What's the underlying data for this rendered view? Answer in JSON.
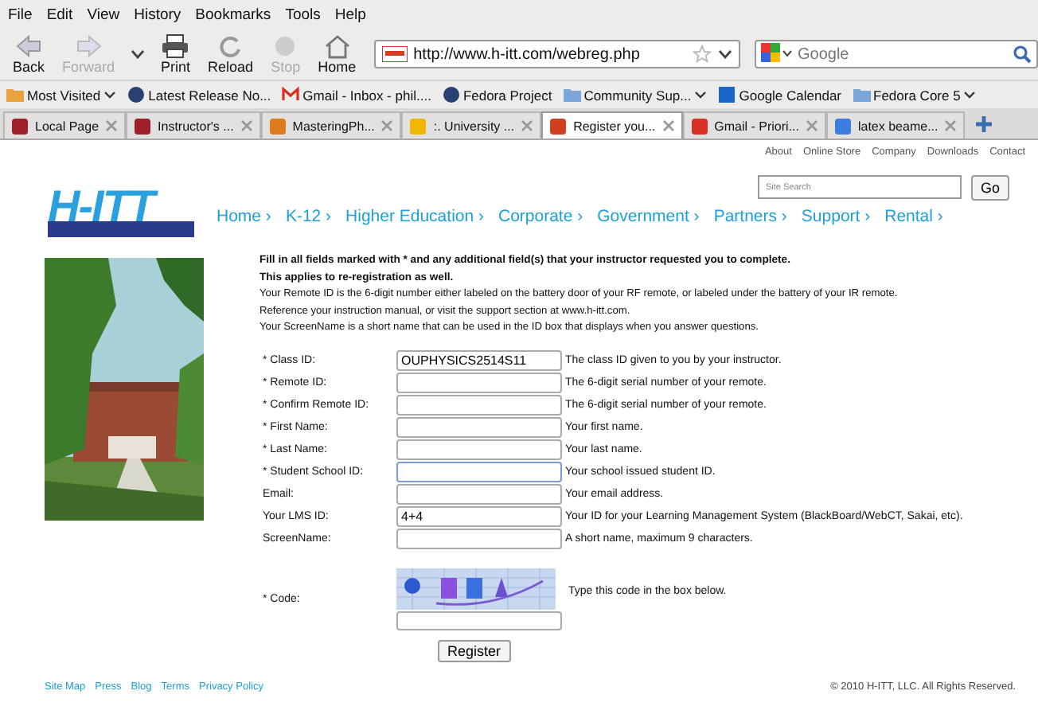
{
  "menu": [
    "File",
    "Edit",
    "View",
    "History",
    "Bookmarks",
    "Tools",
    "Help"
  ],
  "toolbar": [
    {
      "kind": "back",
      "label": "Back",
      "disabled": false
    },
    {
      "kind": "forward",
      "label": "Forward",
      "disabled": true
    },
    {
      "kind": "dropdown"
    },
    {
      "kind": "print",
      "label": "Print",
      "disabled": false
    },
    {
      "kind": "reload",
      "label": "Reload",
      "disabled": false
    },
    {
      "kind": "stop",
      "label": "Stop",
      "disabled": true
    },
    {
      "kind": "home",
      "label": "Home",
      "disabled": false
    }
  ],
  "address": {
    "value": "http://www.h-itt.com/webreg.php"
  },
  "search": {
    "placeholder": "Google"
  },
  "bookmarks": [
    {
      "kind": "folder",
      "label": "Most Visited",
      "menu": true
    },
    {
      "kind": "fedora",
      "label": "Latest Release No...",
      "menu": false
    },
    {
      "kind": "gmail",
      "label": "Gmail - Inbox - phil....",
      "menu": false
    },
    {
      "kind": "fedora",
      "label": "Fedora Project",
      "menu": false
    },
    {
      "kind": "folder",
      "label": "Community Sup...",
      "menu": true
    },
    {
      "kind": "calendar",
      "label": "Google Calendar",
      "menu": false
    },
    {
      "kind": "folder",
      "label": "Fedora Core 5",
      "menu": true
    }
  ],
  "tabs": [
    {
      "kind": "local",
      "label": "Local Page",
      "selected": false
    },
    {
      "kind": "local",
      "label": "Instructor's ...",
      "selected": false
    },
    {
      "kind": "mastering",
      "label": "MasteringPh...",
      "selected": false
    },
    {
      "kind": "star",
      "label": ":. University ...",
      "selected": false
    },
    {
      "kind": "hitt",
      "label": "Register you...",
      "selected": true
    },
    {
      "kind": "gmail",
      "label": "Gmail - Priori...",
      "selected": false
    },
    {
      "kind": "google",
      "label": "latex beame...",
      "selected": false
    }
  ],
  "page": {
    "top_links": [
      "About",
      "Online Store",
      "Company",
      "Downloads",
      "Contact"
    ],
    "logo": "H-ITT",
    "site_search": {
      "placeholder": "Site Search",
      "button": "Go"
    },
    "nav": [
      "Home ›",
      "K-12 ›",
      "Higher Education ›",
      "Corporate ›",
      "Government ›",
      "Partners ›",
      "Support ›",
      "Rental ›"
    ],
    "photo": {
      "kind": "picture"
    },
    "intro_bold": [
      "Fill in all fields marked with * and any additional field(s) that your instructor requested you to complete.",
      "This applies to re-registration as well."
    ],
    "intro": [
      "Your Remote ID is the 6-digit number either labeled on the battery door of your RF remote, or labeled under the battery of your IR remote.",
      "Reference your instruction manual, or visit the support section at www.h-itt.com.",
      "Your ScreenName is a short name that can be used in the ID box that displays when you answer questions."
    ],
    "fields": [
      {
        "label": "* Class ID:",
        "value": "OUPHYSICS2514S11",
        "help": "The class ID given to you by your instructor.",
        "focused": false
      },
      {
        "label": "* Remote ID:",
        "help": "The 6-digit serial number of your remote.",
        "focused": false
      },
      {
        "label": "* Confirm Remote ID:",
        "help": "The 6-digit serial number of your remote.",
        "focused": false
      },
      {
        "label": "* First Name:",
        "help": "Your first name.",
        "focused": false
      },
      {
        "label": "* Last Name:",
        "help": "Your last name.",
        "focused": false
      },
      {
        "label": "* Student School ID:",
        "help": "Your school issued student ID.",
        "focused": true
      },
      {
        "label": "Email:",
        "help": "Your email address.",
        "focused": false
      },
      {
        "label": "Your LMS ID:",
        "value": "4+4",
        "help": "Your ID for your Learning Management System (BlackBoard/WebCT, Sakai, etc).",
        "focused": false
      },
      {
        "label": "ScreenName:",
        "help": "A short name, maximum 9 characters.",
        "focused": false
      }
    ],
    "code": {
      "label": "* Code:",
      "help": "Type this code in the box below."
    },
    "submit": "Register",
    "footer_links": [
      "Site Map",
      "Press",
      "Blog",
      "Terms",
      "Privacy Policy"
    ],
    "copyright": "© 2010 H-ITT, LLC. All Rights Reserved."
  }
}
